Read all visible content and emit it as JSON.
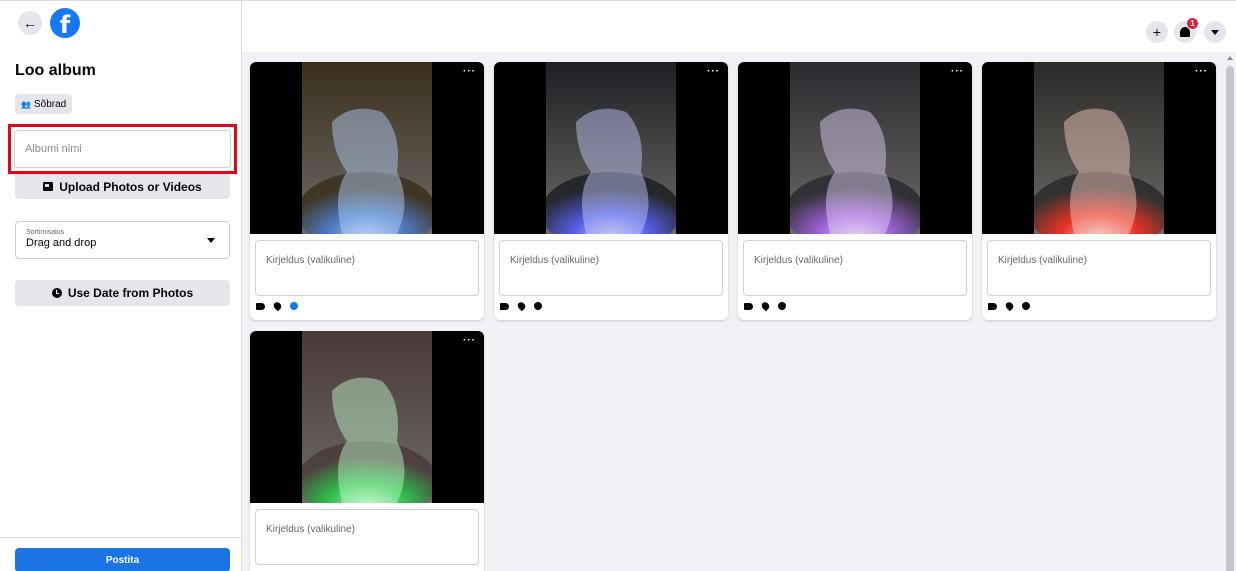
{
  "left_panel": {
    "title": "Loo album",
    "audience_label": "Sõbrad",
    "album_name_placeholder": "Albumi nimi",
    "upload_label": "Upload Photos or Videos",
    "sort": {
      "label": "Sortimisalus",
      "value": "Drag and drop"
    },
    "date_label": "Use Date from Photos",
    "post_label": "Postita"
  },
  "topbar": {
    "notification_count": "1"
  },
  "photos": [
    {
      "description_placeholder": "Kirjeldus (valikuline)",
      "more": "···",
      "sculpture": "wolf",
      "date_active": true,
      "colors": {
        "bg": "#3a2f1c",
        "glow": "#4a7fd6",
        "light": "#b9d6ff"
      }
    },
    {
      "description_placeholder": "Kirjeldus (valikuline)",
      "more": "···",
      "sculpture": "rabbit",
      "date_active": false,
      "colors": {
        "bg": "#1d1f24",
        "glow": "#4f5dff",
        "light": "#c8ceff"
      }
    },
    {
      "description_placeholder": "Kirjeldus (valikuline)",
      "more": "···",
      "sculpture": "squirrel",
      "date_active": false,
      "colors": {
        "bg": "#2a2a30",
        "glow": "#a35ee6",
        "light": "#e8d6ff"
      }
    },
    {
      "description_placeholder": "Kirjeldus (valikuline)",
      "more": "···",
      "sculpture": "penguin",
      "date_active": false,
      "colors": {
        "bg": "#2b2a28",
        "glow": "#ff2a1a",
        "light": "#ffd0c8"
      }
    },
    {
      "description_placeholder": "Kirjeldus (valikuline)",
      "more": "···",
      "sculpture": "bird",
      "date_active": false,
      "colors": {
        "bg": "#4a3a3a",
        "glow": "#24d24a",
        "light": "#c8ffd2"
      }
    }
  ]
}
